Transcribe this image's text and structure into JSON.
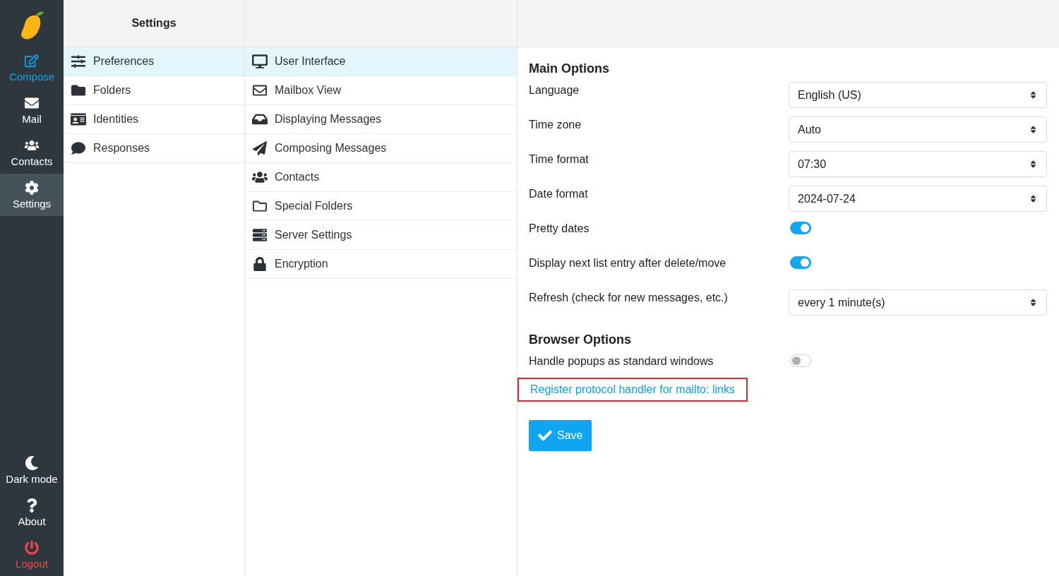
{
  "nav": {
    "top": [
      {
        "label": "Compose",
        "kind": "accent",
        "selected": false
      },
      {
        "label": "Mail",
        "kind": "plain",
        "selected": false
      },
      {
        "label": "Contacts",
        "kind": "plain",
        "selected": false
      },
      {
        "label": "Settings",
        "kind": "plain",
        "selected": true
      }
    ],
    "bottom": [
      {
        "label": "Dark mode",
        "kind": "plain"
      },
      {
        "label": "About",
        "kind": "plain"
      },
      {
        "label": "Logout",
        "kind": "danger"
      }
    ]
  },
  "settings": {
    "title": "Settings",
    "items": [
      {
        "label": "Preferences",
        "selected": true
      },
      {
        "label": "Folders",
        "selected": false
      },
      {
        "label": "Identities",
        "selected": false
      },
      {
        "label": "Responses",
        "selected": false
      }
    ]
  },
  "sections": [
    {
      "label": "User Interface",
      "selected": true
    },
    {
      "label": "Mailbox View",
      "selected": false
    },
    {
      "label": "Displaying Messages",
      "selected": false
    },
    {
      "label": "Composing Messages",
      "selected": false
    },
    {
      "label": "Contacts",
      "selected": false
    },
    {
      "label": "Special Folders",
      "selected": false
    },
    {
      "label": "Server Settings",
      "selected": false
    },
    {
      "label": "Encryption",
      "selected": false
    }
  ],
  "groups": [
    {
      "title": "Main Options",
      "options": [
        {
          "label": "Language",
          "kind": "select",
          "value": "English (US)"
        },
        {
          "label": "Time zone",
          "kind": "select",
          "value": "Auto"
        },
        {
          "label": "Time format",
          "kind": "select",
          "value": "07:30"
        },
        {
          "label": "Date format",
          "kind": "select",
          "value": "2024-07-24"
        },
        {
          "label": "Pretty dates",
          "kind": "toggle",
          "on": true
        },
        {
          "label": "Display next list entry after delete/move",
          "kind": "toggle",
          "on": true
        },
        {
          "label": "Refresh (check for new messages, etc.)",
          "kind": "select",
          "value": "every 1 minute(s)"
        }
      ]
    },
    {
      "title": "Browser Options",
      "options": [
        {
          "label": "Handle popups as standard windows",
          "kind": "toggle",
          "on": false
        }
      ]
    }
  ],
  "link": {
    "label": "Register protocol handler for mailto: links",
    "highlighted": true
  },
  "save_button": "Save"
}
